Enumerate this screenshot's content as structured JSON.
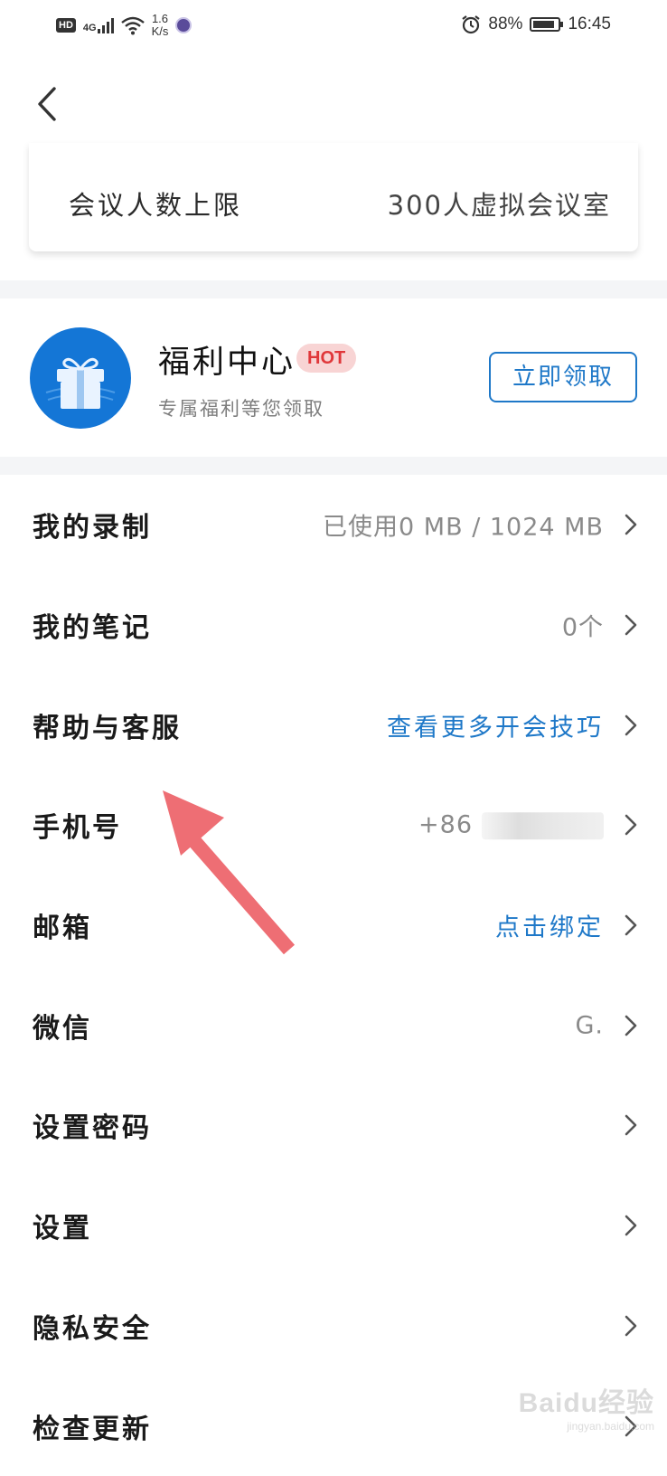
{
  "status_bar": {
    "hd": "HD",
    "network": "4G",
    "speed_value": "1.6",
    "speed_unit": "K/s",
    "battery": "88%",
    "battery_level": 0.88,
    "time": "16:45"
  },
  "header": {
    "back_icon": "chevron-left-icon"
  },
  "meeting_card": {
    "key": "会议人数上限",
    "value": "300人虚拟会议室"
  },
  "welfare": {
    "title": "福利中心",
    "badge": "HOT",
    "subtitle": "专属福利等您领取",
    "button": "立即领取",
    "icon": "gift-icon"
  },
  "menu": {
    "items": [
      {
        "label": "我的录制",
        "value": "已使用0 MB / 1024 MB"
      },
      {
        "label": "我的笔记",
        "value": "0个"
      },
      {
        "label": "帮助与客服",
        "value": "查看更多开会技巧"
      },
      {
        "label": "手机号",
        "value": "+86"
      },
      {
        "label": "邮箱",
        "value": "点击绑定"
      },
      {
        "label": "微信",
        "value": "G."
      },
      {
        "label": "设置密码",
        "value": ""
      },
      {
        "label": "设置",
        "value": ""
      },
      {
        "label": "隐私安全",
        "value": ""
      },
      {
        "label": "检查更新",
        "value": ""
      }
    ]
  },
  "watermark": {
    "text": "Baidu经验",
    "sub": "jingyan.baidu.com"
  },
  "colors": {
    "accent": "#1e78c8",
    "hot_badge_bg": "#f8d4d4",
    "hot_badge_text": "#e0373a",
    "annotation_arrow": "#ee6e74"
  }
}
